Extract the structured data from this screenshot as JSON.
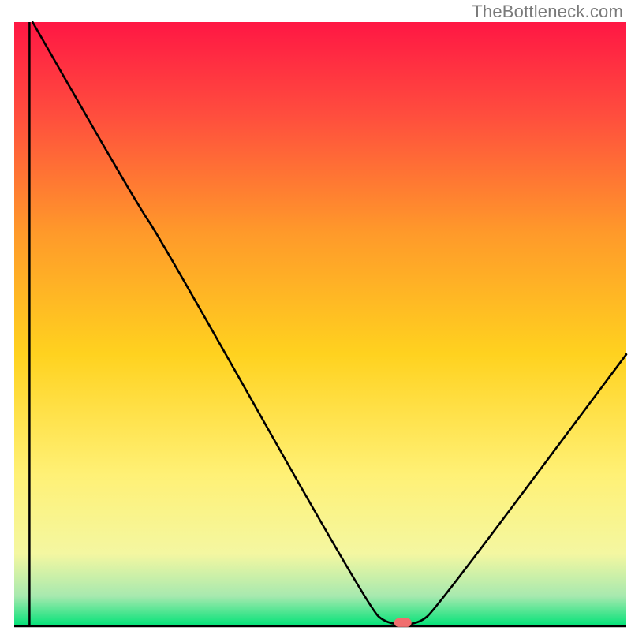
{
  "watermark": "TheBottleneck.com",
  "chart_data": {
    "type": "line",
    "title": "",
    "xlabel": "",
    "ylabel": "",
    "xlim": [
      0,
      100
    ],
    "ylim": [
      0,
      100
    ],
    "grid": false,
    "legend": false,
    "background": {
      "type": "vertical-gradient",
      "stops": [
        {
          "pos": 0.0,
          "color": "#ff1744"
        },
        {
          "pos": 0.15,
          "color": "#ff4c3e"
        },
        {
          "pos": 0.35,
          "color": "#ff9a2a"
        },
        {
          "pos": 0.55,
          "color": "#ffd21f"
        },
        {
          "pos": 0.75,
          "color": "#fff176"
        },
        {
          "pos": 0.88,
          "color": "#f4f7a1"
        },
        {
          "pos": 0.95,
          "color": "#a7e9af"
        },
        {
          "pos": 1.0,
          "color": "#00e277"
        }
      ]
    },
    "series": [
      {
        "name": "bottleneck-curve",
        "color": "#000000",
        "points": [
          {
            "x": 3.0,
            "y": 100.0
          },
          {
            "x": 20.0,
            "y": 70.0
          },
          {
            "x": 24.0,
            "y": 64.0
          },
          {
            "x": 58.0,
            "y": 3.0
          },
          {
            "x": 61.0,
            "y": 0.3
          },
          {
            "x": 66.0,
            "y": 0.3
          },
          {
            "x": 69.0,
            "y": 3.0
          },
          {
            "x": 100.0,
            "y": 45.0
          }
        ]
      }
    ],
    "marker": {
      "name": "sweet-spot",
      "x": 63.5,
      "y": 0.6,
      "color": "#f06e6e",
      "shape": "pill"
    },
    "axes": {
      "left": {
        "x": 2.5,
        "color": "#000",
        "width": 2.5
      },
      "bottom": {
        "y": 0.0,
        "color": "#000",
        "width": 2.5
      }
    }
  }
}
